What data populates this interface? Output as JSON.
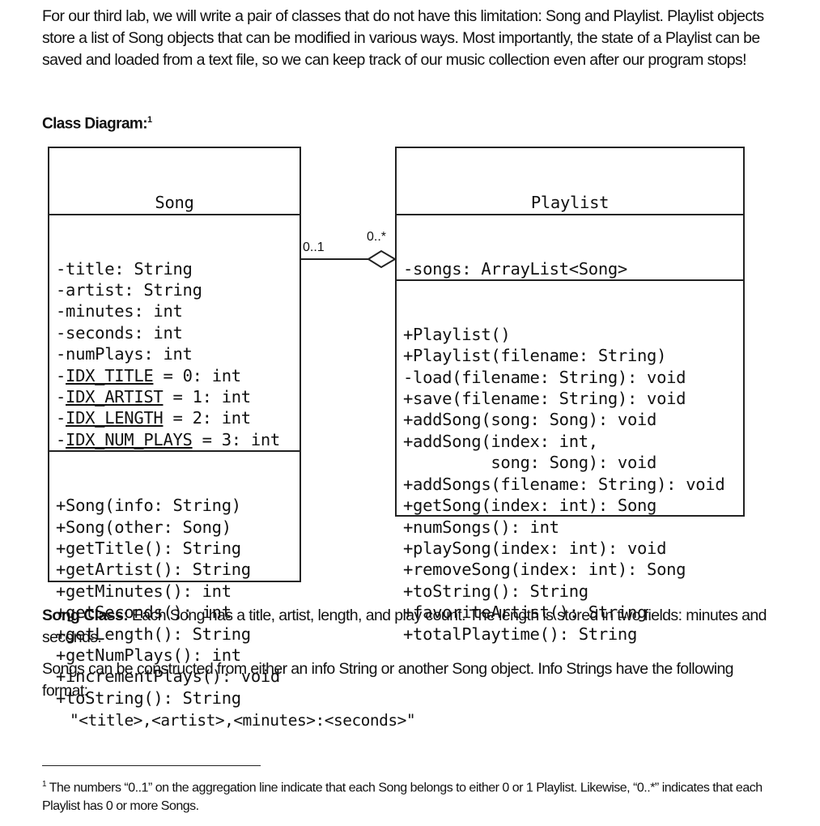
{
  "intro": "For our third lab, we will write a pair of classes that do not have this limitation: Song and Playlist. Playlist objects store a list of Song objects that can be modified in various ways. Most importantly, the state of a Playlist can be saved and loaded from a text file, so we can keep track of our music collection even after our program stops!",
  "class_diagram_heading": "Class Diagram:",
  "footnote_mark": "1",
  "song": {
    "name": "Song",
    "attributes": [
      {
        "text": "-title: String"
      },
      {
        "text": "-artist: String"
      },
      {
        "text": "-minutes: int"
      },
      {
        "text": "-seconds: int"
      },
      {
        "text": "-numPlays: int"
      },
      {
        "prefix": "-",
        "static": "IDX_TITLE",
        "suffix": " = 0: int"
      },
      {
        "prefix": "-",
        "static": "IDX_ARTIST",
        "suffix": " = 1: int"
      },
      {
        "prefix": "-",
        "static": "IDX_LENGTH",
        "suffix": " = 2: int"
      },
      {
        "prefix": "-",
        "static": "IDX_NUM_PLAYS",
        "suffix": " = 3: int"
      }
    ],
    "methods": [
      "+Song(info: String)",
      "+Song(other: Song)",
      "+getTitle(): String",
      "+getArtist(): String",
      "+getMinutes(): int",
      "+getSeconds(): int",
      "+getLength(): String",
      "+getNumPlays(): int",
      "+incrementPlays(): void",
      "+toString(): String"
    ]
  },
  "playlist": {
    "name": "Playlist",
    "attributes": [
      "-songs: ArrayList<Song>"
    ],
    "methods": [
      "+Playlist()",
      "+Playlist(filename: String)",
      "-load(filename: String): void",
      "+save(filename: String): void",
      "+addSong(song: Song): void",
      "+addSong(index: int,",
      "         song: Song): void",
      "+addSongs(filename: String): void",
      "+getSong(index: int): Song",
      "+numSongs(): int",
      "+playSong(index: int): void",
      "+removeSong(index: int): Song",
      "+toString(): String",
      "+favoriteArtist(): String",
      "+totalPlaytime(): String"
    ]
  },
  "aggregation": {
    "song_end": "0..1",
    "playlist_end": "0..*"
  },
  "song_class_label": "Song Class:",
  "song_class_text": " Each Song has a title, artist, length, and play count. The length is stored in two fields: minutes and seconds.",
  "songs_constructed_text": "Songs can be constructed from either an info String or another Song object. Info Strings have the following format:",
  "info_format": "\"<title>,<artist>,<minutes>:<seconds>\"",
  "footnote": "The numbers “0..1” on the aggregation line indicate that each Song belongs to either 0 or 1 Playlist. Likewise, “0..*” indicates that each Playlist has 0 or more Songs."
}
